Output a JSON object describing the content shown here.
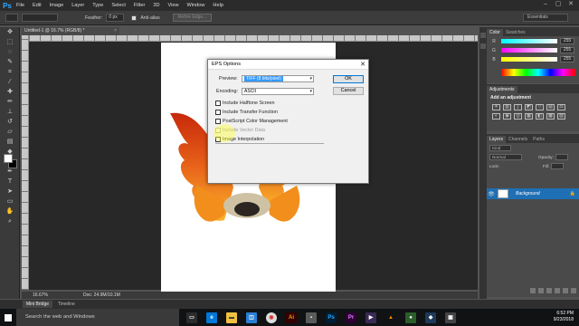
{
  "app": {
    "logo": "Ps"
  },
  "menu": [
    "File",
    "Edit",
    "Image",
    "Layer",
    "Type",
    "Select",
    "Filter",
    "3D",
    "View",
    "Window",
    "Help"
  ],
  "window_controls": [
    "–",
    "▢",
    "✕"
  ],
  "options_bar": {
    "feather_label": "Feather:",
    "feather_value": "0 px",
    "antialias_label": "Anti-alias",
    "refine_edge": "Refine Edge...",
    "workspace": "Essentials"
  },
  "document": {
    "tab_title": "Untitled-1 @ 16.7% (RGB/8) *",
    "tab_close": "×",
    "zoom": "16.67%",
    "doc_size": "Doc: 24.9M/10.1M"
  },
  "bottom_tabs": {
    "mini_bridge": "Mini Bridge",
    "timeline": "Timeline"
  },
  "color_panel": {
    "tabs": [
      "Color",
      "Swatches"
    ],
    "channels": [
      {
        "label": "R",
        "value": "255"
      },
      {
        "label": "G",
        "value": "255"
      },
      {
        "label": "B",
        "value": "255"
      }
    ]
  },
  "adjustments_panel": {
    "tab": "Adjustments",
    "title": "Add an adjustment"
  },
  "layers_panel": {
    "tabs": [
      "Layers",
      "Channels",
      "Paths"
    ],
    "kind_label": "Kind",
    "blend_mode": "Normal",
    "opacity_label": "Opacity:",
    "lock_label": "Lock:",
    "fill_label": "Fill:",
    "layer_name": "Background"
  },
  "eps_dialog": {
    "title": "EPS Options",
    "preview_label": "Preview:",
    "preview_value": "TIFF (8 bits/pixel)",
    "encoding_label": "Encoding:",
    "encoding_value": "ASCII",
    "ok_label": "OK",
    "cancel_label": "Cancel",
    "checkboxes": [
      {
        "label": "Include Halftone Screen",
        "checked": false,
        "enabled": true
      },
      {
        "label": "Include Transfer Function",
        "checked": false,
        "enabled": true
      },
      {
        "label": "PostScript Color Management",
        "checked": false,
        "enabled": true
      },
      {
        "label": "Include Vector Data",
        "checked": false,
        "enabled": false
      },
      {
        "label": "Image Interpolation",
        "checked": false,
        "enabled": true
      }
    ]
  },
  "taskbar": {
    "search_placeholder": "Search the web and Windows",
    "time": "6:52 PM",
    "date": "9/23/2018"
  },
  "colors": {
    "accent": "#31a8ff",
    "layer_selected": "#1f6fb4",
    "flame_dark": "#d8320c",
    "flame_light": "#f7a21a"
  }
}
